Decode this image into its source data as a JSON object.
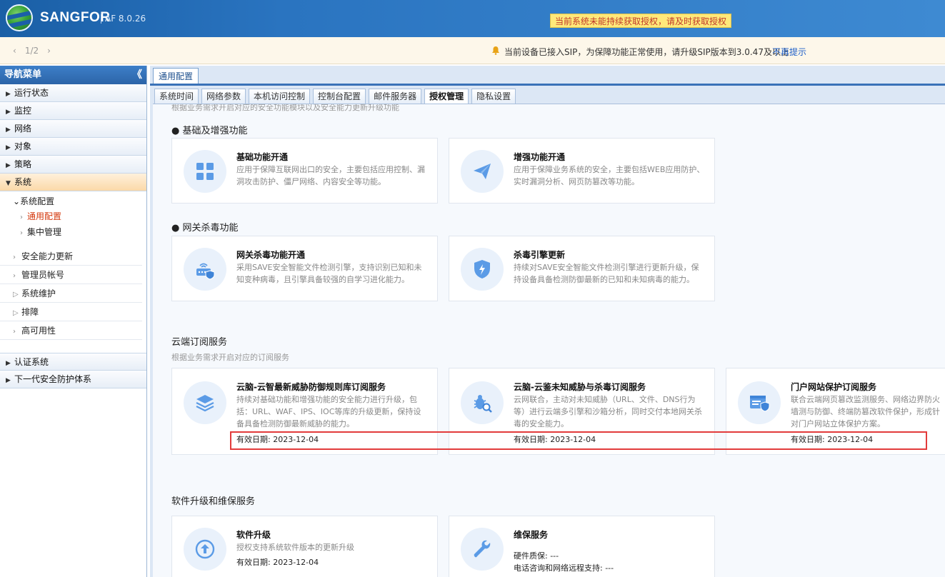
{
  "header": {
    "brand": "SANGFOR",
    "version": "AF 8.0.26",
    "license_warning": "当前系统未能持续获取授权，请及时获取授权"
  },
  "notice": {
    "pager": "1/2",
    "message": "当前设备已接入SIP，为保障功能正常使用，请升级SIP版本到3.0.47及以上",
    "dismiss": "不再提示"
  },
  "sidebar": {
    "title": "导航菜单",
    "collapse": "《",
    "top_items": [
      "运行状态",
      "监控",
      "网络",
      "对象",
      "策略"
    ],
    "active_item": "系统",
    "system_config": "系统配置",
    "system_config_children": [
      "通用配置",
      "集中管理"
    ],
    "system_rows": [
      "安全能力更新",
      "管理员帐号",
      "系统维护",
      "排障",
      "高可用性"
    ],
    "bottom_items": [
      "认证系统",
      "下一代安全防护体系"
    ]
  },
  "main": {
    "page_tab": "通用配置",
    "subtabs": [
      "系统时间",
      "网络参数",
      "本机访问控制",
      "控制台配置",
      "邮件服务器",
      "授权管理",
      "隐私设置"
    ],
    "active_subtab": "授权管理",
    "top_hint": "根据业务需求开启对应的安全功能模块以及安全能力更新升级功能",
    "sections": {
      "basic": {
        "title": "基础及增强功能",
        "cards": [
          {
            "title": "基础功能开通",
            "desc": "应用于保障互联网出口的安全，主要包括应用控制、漏洞攻击防护、僵尸网络、内容安全等功能。",
            "icon": "grid-icon"
          },
          {
            "title": "增强功能开通",
            "desc": "应用于保障业务系统的安全，主要包括WEB应用防护、实时漏洞分析、网页防篡改等功能。",
            "icon": "paper-plane-icon"
          }
        ]
      },
      "antivirus": {
        "title": "网关杀毒功能",
        "cards": [
          {
            "title": "网关杀毒功能开通",
            "desc": "采用SAVE安全智能文件检测引擎，支持识别已知和未知变种病毒，且引擎具备较强的自学习进化能力。",
            "icon": "router-shield-icon"
          },
          {
            "title": "杀毒引擎更新",
            "desc": "持续对SAVE安全智能文件检测引擎进行更新升级，保持设备具备检测防御最新的已知和未知病毒的能力。",
            "icon": "shield-bolt-icon"
          }
        ]
      },
      "cloud": {
        "title": "云端订阅服务",
        "subtitle": "根据业务需求开启对应的订阅服务",
        "cards": [
          {
            "title": "云脑-云智最新威胁防御规则库订阅服务",
            "desc": "持续对基础功能和增强功能的安全能力进行升级，包括：URL、WAF、IPS、IOC等库的升级更新，保持设备具备检测防御最新威胁的能力。",
            "date": "有效日期: 2023-12-04",
            "icon": "layers-icon"
          },
          {
            "title": "云脑-云鉴未知威胁与杀毒订阅服务",
            "desc": "云网联合，主动对未知威胁（URL、文件、DNS行为等）进行云端多引擎和沙箱分析，同时交付本地网关杀毒的安全能力。",
            "date": "有效日期: 2023-12-04",
            "icon": "bug-search-icon"
          },
          {
            "title": "门户网站保护订阅服务",
            "desc": "联合云端网页篡改监测服务、网络边界防火墙测与防御、终端防篡改软件保护，形成针对门户网站立体保护方案。",
            "date": "有效日期: 2023-12-04",
            "icon": "web-shield-icon"
          }
        ]
      },
      "software": {
        "title": "软件升级和维保服务",
        "cards": [
          {
            "title": "软件升级",
            "desc": "授权支持系统软件版本的更新升级",
            "date": "有效日期: 2023-12-04",
            "icon": "upload-icon"
          },
          {
            "title": "维保服务",
            "line1": "硬件质保: ---",
            "line2": "电话咨询和网络远程支持: ---",
            "icon": "wrench-icon"
          }
        ]
      }
    }
  },
  "colors": {
    "header_blue": "#2a74c0",
    "highlight_red": "#e23b3b",
    "icon_blue": "#5b9be6",
    "active_link": "#d4380d"
  }
}
